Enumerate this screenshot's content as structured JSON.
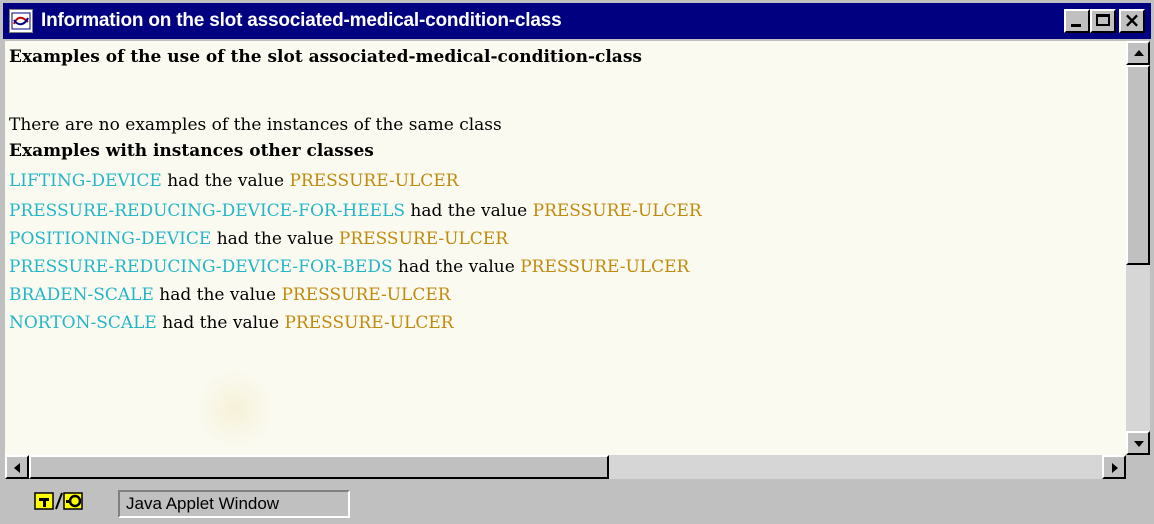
{
  "window": {
    "title": "Information on the slot associated-medical-condition-class"
  },
  "content": {
    "heading": "Examples of the use of the slot associated-medical-condition-class",
    "no_same_class_text": "There are no examples of the instances of the same class",
    "other_classes_heading": "Examples with instances other classes",
    "connector": "had the value",
    "examples": [
      {
        "slot": "LIFTING-DEVICE",
        "value": "PRESSURE-ULCER"
      },
      {
        "slot": "PRESSURE-REDUCING-DEVICE-FOR-HEELS",
        "value": "PRESSURE-ULCER"
      },
      {
        "slot": "POSITIONING-DEVICE",
        "value": "PRESSURE-ULCER"
      },
      {
        "slot": "PRESSURE-REDUCING-DEVICE-FOR-BEDS",
        "value": "PRESSURE-ULCER"
      },
      {
        "slot": "BRADEN-SCALE",
        "value": "PRESSURE-ULCER"
      },
      {
        "slot": "NORTON-SCALE",
        "value": "PRESSURE-ULCER"
      }
    ]
  },
  "status": {
    "label": "Java Applet Window"
  },
  "colors": {
    "titlebar": "#000080",
    "slot_text": "#22b6c8",
    "value_text": "#c08a0c",
    "content_bg": "#fafaf0"
  },
  "icons": [
    "app-window-icon",
    "minimize-icon",
    "maximize-icon",
    "close-icon",
    "java-key-icon"
  ]
}
